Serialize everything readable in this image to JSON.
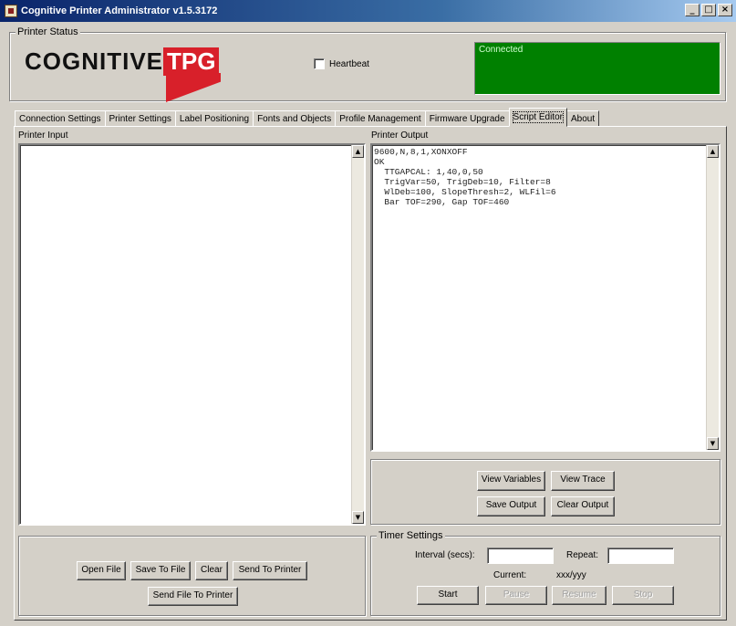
{
  "window": {
    "title": "Cognitive Printer Administrator v1.5.3172",
    "min_glyph": "_",
    "max_glyph": "□",
    "close_glyph": "×"
  },
  "status": {
    "group_label": "Printer Status",
    "logo_text": "COGNITIVE",
    "logo_highlight": "TPG",
    "heartbeat_label": "Heartbeat",
    "heartbeat_checked": false,
    "connection_text": "Connected",
    "connection_color": "#008000"
  },
  "tabs": [
    {
      "label": "Connection Settings"
    },
    {
      "label": "Printer Settings"
    },
    {
      "label": "Label Positioning"
    },
    {
      "label": "Fonts and Objects"
    },
    {
      "label": "Profile Management"
    },
    {
      "label": "Firmware Upgrade"
    },
    {
      "label": "Script Editor"
    },
    {
      "label": "About"
    }
  ],
  "active_tab": "Script Editor",
  "input_panel": {
    "label": "Printer Input",
    "text": ""
  },
  "output_panel": {
    "label": "Printer Output",
    "text": "9600,N,8,1,XONXOFF\nOK\n  TTGAPCAL: 1,40,0,50\n  TrigVar=50, TrigDeb=10, Filter=8\n  WlDeb=100, SlopeThresh=2, WLFil=6\n  Bar TOF=290, Gap TOF=460"
  },
  "input_buttons": {
    "open_file": "Open File",
    "save_to_file": "Save To File",
    "clear": "Clear",
    "send_to_printer": "Send To Printer",
    "send_file_to_printer": "Send File To Printer"
  },
  "output_buttons": {
    "view_variables": "View Variables",
    "view_trace": "View Trace",
    "save_output": "Save Output",
    "clear_output": "Clear Output"
  },
  "timer": {
    "group_label": "Timer Settings",
    "interval_label": "Interval (secs):",
    "interval_value": "",
    "repeat_label": "Repeat:",
    "repeat_value": "",
    "current_label": "Current:",
    "current_value": "xxx/yyy",
    "start": "Start",
    "pause": "Pause",
    "resume": "Resume",
    "stop": "Stop"
  },
  "icons": {
    "scroll_up": "▲",
    "scroll_down": "▼"
  }
}
